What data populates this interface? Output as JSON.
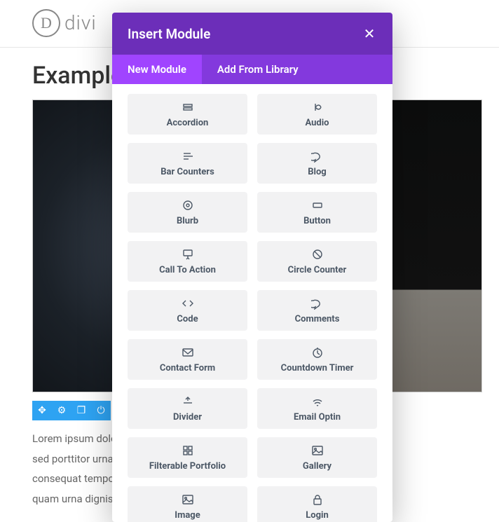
{
  "brand": "divi",
  "page_title": "Example",
  "lorem": "Lorem ipsum dolor sit amet, sollicitudin, leo sed porttitor urna justo interdum metus consequat tempor, augue nisl. Quisque et quam urna dignissim, posuere",
  "toolbar": {
    "move": "move-icon",
    "settings": "gear-icon",
    "duplicate": "duplicate-icon",
    "power": "power-icon"
  },
  "modal": {
    "title": "Insert Module",
    "tabs": {
      "new": "New Module",
      "library": "Add From Library"
    },
    "modules": [
      {
        "label": "Accordion",
        "icon": "accordion"
      },
      {
        "label": "Audio",
        "icon": "audio"
      },
      {
        "label": "Bar Counters",
        "icon": "bars"
      },
      {
        "label": "Blog",
        "icon": "chat"
      },
      {
        "label": "Blurb",
        "icon": "target"
      },
      {
        "label": "Button",
        "icon": "button"
      },
      {
        "label": "Call To Action",
        "icon": "cursor"
      },
      {
        "label": "Circle Counter",
        "icon": "circlecross"
      },
      {
        "label": "Code",
        "icon": "code"
      },
      {
        "label": "Comments",
        "icon": "chat"
      },
      {
        "label": "Contact Form",
        "icon": "mail"
      },
      {
        "label": "Countdown Timer",
        "icon": "clock"
      },
      {
        "label": "Divider",
        "icon": "divider"
      },
      {
        "label": "Email Optin",
        "icon": "wifi"
      },
      {
        "label": "Filterable Portfolio",
        "icon": "grid"
      },
      {
        "label": "Gallery",
        "icon": "image"
      },
      {
        "label": "Image",
        "icon": "image"
      },
      {
        "label": "Login",
        "icon": "lock"
      }
    ]
  }
}
